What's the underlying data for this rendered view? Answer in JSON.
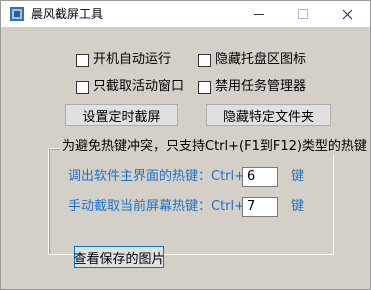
{
  "window": {
    "title": "晨风截屏工具"
  },
  "options": {
    "autostart": {
      "label": "开机自动运行",
      "checked": false
    },
    "hide_tray": {
      "label": "隐藏托盘区图标",
      "checked": false
    },
    "active_window_only": {
      "label": "只截取活动窗口",
      "checked": false
    },
    "disable_task_manager": {
      "label": "禁用任务管理器",
      "checked": false
    }
  },
  "buttons": {
    "schedule": "设置定时截屏",
    "hide_folder": "隐藏特定文件夹",
    "view_saved": "查看保存的图片"
  },
  "hotkeys": {
    "group_title": "为避免热键冲突，只支持Ctrl+(F1到F12)类型的热键",
    "main_ui": {
      "label": "调出软件主界面的热键：Ctrl+ F",
      "value": "6",
      "suffix": "键"
    },
    "capture": {
      "label": "手动截取当前屏幕热键：Ctrl+ F",
      "value": "7",
      "suffix": "键"
    }
  },
  "colors": {
    "hotkey_text": "#1e73c8",
    "dialog_bg": "#d4d0c8",
    "focus_border": "#0078d7"
  },
  "icons": {
    "app": "camera-icon"
  }
}
